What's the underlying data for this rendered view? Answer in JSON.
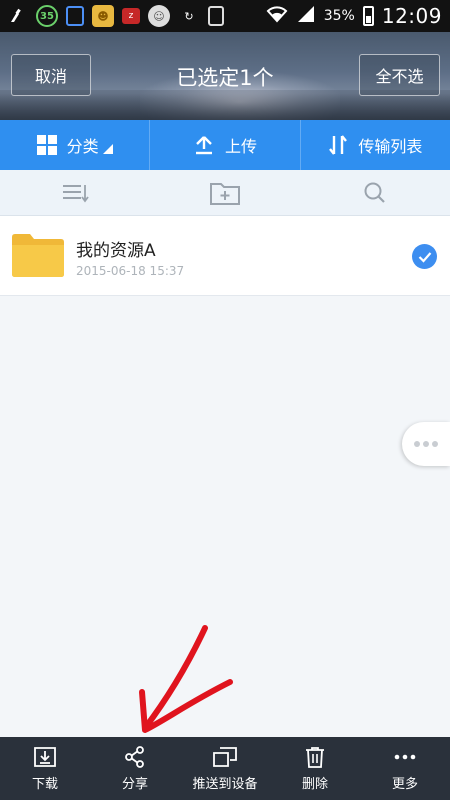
{
  "status_bar": {
    "badge_number": "35",
    "battery_percent": "35%",
    "time": "12:09"
  },
  "header": {
    "cancel_label": "取消",
    "title": "已选定1个",
    "deselect_all_label": "全不选"
  },
  "toolbar": {
    "category_label": "分类",
    "upload_label": "上传",
    "transfer_list_label": "传输列表"
  },
  "files": [
    {
      "name": "我的资源A",
      "date": "2015-06-18  15:37",
      "selected": true
    }
  ],
  "bottom_bar": {
    "download_label": "下载",
    "share_label": "分享",
    "push_label": "推送到设备",
    "delete_label": "删除",
    "more_label": "更多"
  },
  "colors": {
    "accent_blue": "#2f8ff0",
    "bottom_bar": "#2a313b",
    "folder_yellow": "#f5c842",
    "annotation_red": "#e0141e"
  }
}
